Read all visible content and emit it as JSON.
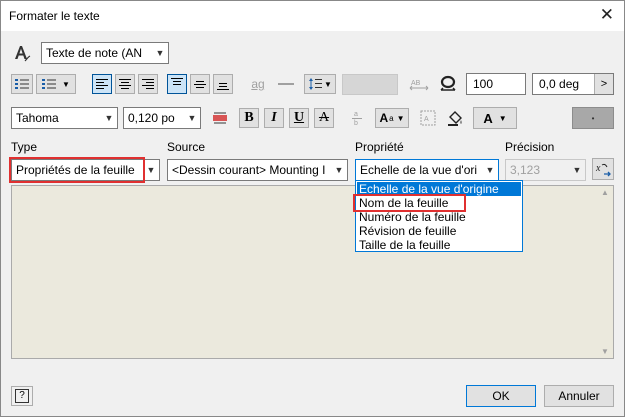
{
  "window": {
    "title": "Formater le texte"
  },
  "style_select": {
    "value": "Texte de note (AN"
  },
  "toolbar1": {
    "spacing_value": "100",
    "rotation_value": "0,0 deg",
    "stack_label": "ag"
  },
  "toolbar2": {
    "font_value": "Tahoma",
    "size_value": "0,120 po",
    "bold_label": "B",
    "italic_label": "I",
    "underline_label": "U",
    "strike_label": "A",
    "color_label": "A"
  },
  "fields": {
    "type_label": "Type",
    "type_value": "Propriétés de la feuille",
    "source_label": "Source",
    "source_value": "<Dessin courant> Mounting I",
    "property_label": "Propriété",
    "property_value": "Echelle de la vue d'ori",
    "precision_label": "Précision",
    "precision_value": "3,123",
    "property_options": [
      "Echelle de la vue d'origine",
      "Nom de la feuille",
      "Numéro de la feuille",
      "Révision de feuille",
      "Taille de la feuille"
    ]
  },
  "footer": {
    "help_label": "?",
    "ok_label": "OK",
    "cancel_label": "Annuler"
  },
  "colors": {
    "highlight_red": "#e03030",
    "selection_blue": "#0078d7",
    "text_area_bg": "#ebe9dd"
  }
}
